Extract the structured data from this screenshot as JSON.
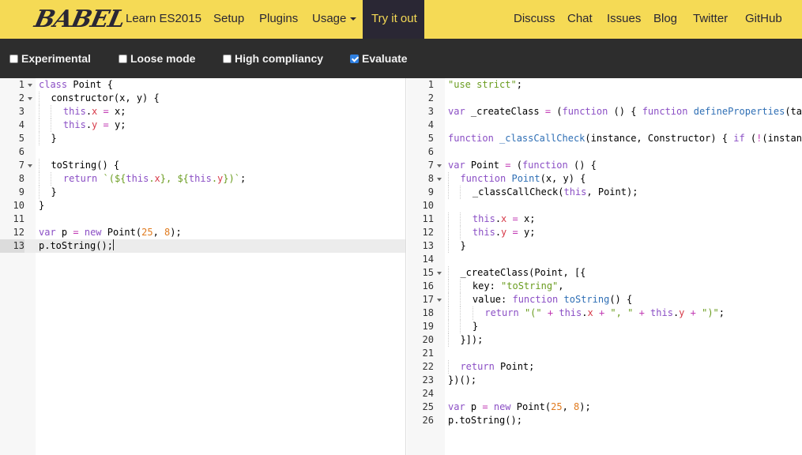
{
  "topnav": {
    "logo": "BABEL",
    "items": [
      {
        "label": "Learn ES2015"
      },
      {
        "label": "Setup"
      },
      {
        "label": "Plugins"
      },
      {
        "label": "Usage"
      },
      {
        "label": "Try it out"
      },
      {
        "label": "Discuss"
      },
      {
        "label": "Chat"
      },
      {
        "label": "Issues"
      },
      {
        "label": "Blog"
      },
      {
        "label": "Twitter"
      },
      {
        "label": "GitHub"
      }
    ]
  },
  "options": [
    {
      "label": "Experimental",
      "checked": false
    },
    {
      "label": "Loose mode",
      "checked": false
    },
    {
      "label": "High compliancy",
      "checked": false
    },
    {
      "label": "Evaluate",
      "checked": true
    }
  ],
  "input_editor": {
    "lines": [
      "class Point {",
      "  constructor(x, y) {",
      "    this.x = x;",
      "    this.y = y;",
      "  }",
      "",
      "  toString() {",
      "    return `(${this.x}, ${this.y})`;",
      "  }",
      "}",
      "",
      "var p = new Point(25, 8);",
      "p.toString();"
    ],
    "folds": [
      1,
      2,
      7
    ],
    "current_line": 13
  },
  "output_editor": {
    "lines": [
      "\"use strict\";",
      "",
      "var _createClass = (function () { function defineProperties(ta",
      "",
      "function _classCallCheck(instance, Constructor) { if (!(instan",
      "",
      "var Point = (function () {",
      "  function Point(x, y) {",
      "    _classCallCheck(this, Point);",
      "",
      "    this.x = x;",
      "    this.y = y;",
      "  }",
      "",
      "  _createClass(Point, [{",
      "    key: \"toString\",",
      "    value: function toString() {",
      "      return \"(\" + this.x + \", \" + this.y + \")\";",
      "    }",
      "  }]);",
      "",
      "  return Point;",
      "})();",
      "",
      "var p = new Point(25, 8);",
      "p.toString();"
    ],
    "folds": [
      7,
      8,
      15,
      17
    ]
  }
}
